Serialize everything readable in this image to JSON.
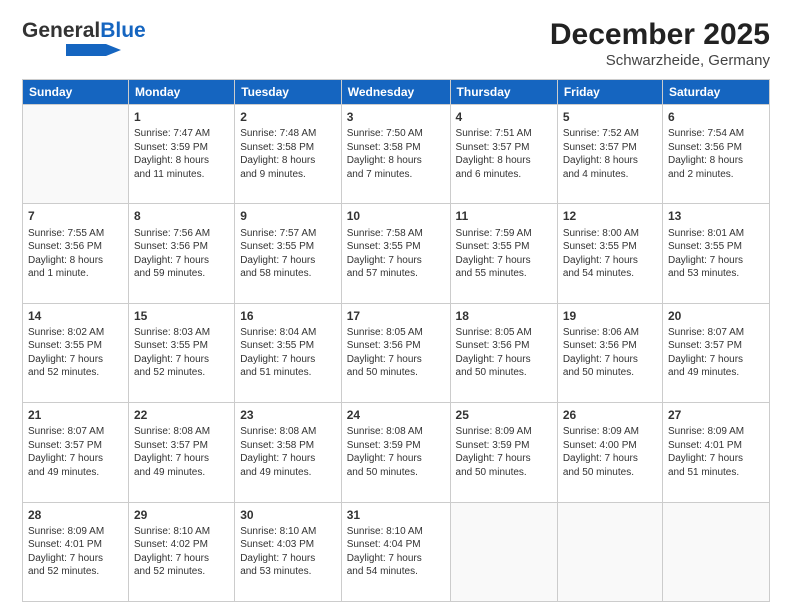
{
  "header": {
    "logo_general": "General",
    "logo_blue": "Blue",
    "month": "December 2025",
    "location": "Schwarzheide, Germany"
  },
  "weekdays": [
    "Sunday",
    "Monday",
    "Tuesday",
    "Wednesday",
    "Thursday",
    "Friday",
    "Saturday"
  ],
  "weeks": [
    [
      {
        "day": "",
        "info": ""
      },
      {
        "day": "1",
        "info": "Sunrise: 7:47 AM\nSunset: 3:59 PM\nDaylight: 8 hours\nand 11 minutes."
      },
      {
        "day": "2",
        "info": "Sunrise: 7:48 AM\nSunset: 3:58 PM\nDaylight: 8 hours\nand 9 minutes."
      },
      {
        "day": "3",
        "info": "Sunrise: 7:50 AM\nSunset: 3:58 PM\nDaylight: 8 hours\nand 7 minutes."
      },
      {
        "day": "4",
        "info": "Sunrise: 7:51 AM\nSunset: 3:57 PM\nDaylight: 8 hours\nand 6 minutes."
      },
      {
        "day": "5",
        "info": "Sunrise: 7:52 AM\nSunset: 3:57 PM\nDaylight: 8 hours\nand 4 minutes."
      },
      {
        "day": "6",
        "info": "Sunrise: 7:54 AM\nSunset: 3:56 PM\nDaylight: 8 hours\nand 2 minutes."
      }
    ],
    [
      {
        "day": "7",
        "info": "Sunrise: 7:55 AM\nSunset: 3:56 PM\nDaylight: 8 hours\nand 1 minute."
      },
      {
        "day": "8",
        "info": "Sunrise: 7:56 AM\nSunset: 3:56 PM\nDaylight: 7 hours\nand 59 minutes."
      },
      {
        "day": "9",
        "info": "Sunrise: 7:57 AM\nSunset: 3:55 PM\nDaylight: 7 hours\nand 58 minutes."
      },
      {
        "day": "10",
        "info": "Sunrise: 7:58 AM\nSunset: 3:55 PM\nDaylight: 7 hours\nand 57 minutes."
      },
      {
        "day": "11",
        "info": "Sunrise: 7:59 AM\nSunset: 3:55 PM\nDaylight: 7 hours\nand 55 minutes."
      },
      {
        "day": "12",
        "info": "Sunrise: 8:00 AM\nSunset: 3:55 PM\nDaylight: 7 hours\nand 54 minutes."
      },
      {
        "day": "13",
        "info": "Sunrise: 8:01 AM\nSunset: 3:55 PM\nDaylight: 7 hours\nand 53 minutes."
      }
    ],
    [
      {
        "day": "14",
        "info": "Sunrise: 8:02 AM\nSunset: 3:55 PM\nDaylight: 7 hours\nand 52 minutes."
      },
      {
        "day": "15",
        "info": "Sunrise: 8:03 AM\nSunset: 3:55 PM\nDaylight: 7 hours\nand 52 minutes."
      },
      {
        "day": "16",
        "info": "Sunrise: 8:04 AM\nSunset: 3:55 PM\nDaylight: 7 hours\nand 51 minutes."
      },
      {
        "day": "17",
        "info": "Sunrise: 8:05 AM\nSunset: 3:56 PM\nDaylight: 7 hours\nand 50 minutes."
      },
      {
        "day": "18",
        "info": "Sunrise: 8:05 AM\nSunset: 3:56 PM\nDaylight: 7 hours\nand 50 minutes."
      },
      {
        "day": "19",
        "info": "Sunrise: 8:06 AM\nSunset: 3:56 PM\nDaylight: 7 hours\nand 50 minutes."
      },
      {
        "day": "20",
        "info": "Sunrise: 8:07 AM\nSunset: 3:57 PM\nDaylight: 7 hours\nand 49 minutes."
      }
    ],
    [
      {
        "day": "21",
        "info": "Sunrise: 8:07 AM\nSunset: 3:57 PM\nDaylight: 7 hours\nand 49 minutes."
      },
      {
        "day": "22",
        "info": "Sunrise: 8:08 AM\nSunset: 3:57 PM\nDaylight: 7 hours\nand 49 minutes."
      },
      {
        "day": "23",
        "info": "Sunrise: 8:08 AM\nSunset: 3:58 PM\nDaylight: 7 hours\nand 49 minutes."
      },
      {
        "day": "24",
        "info": "Sunrise: 8:08 AM\nSunset: 3:59 PM\nDaylight: 7 hours\nand 50 minutes."
      },
      {
        "day": "25",
        "info": "Sunrise: 8:09 AM\nSunset: 3:59 PM\nDaylight: 7 hours\nand 50 minutes."
      },
      {
        "day": "26",
        "info": "Sunrise: 8:09 AM\nSunset: 4:00 PM\nDaylight: 7 hours\nand 50 minutes."
      },
      {
        "day": "27",
        "info": "Sunrise: 8:09 AM\nSunset: 4:01 PM\nDaylight: 7 hours\nand 51 minutes."
      }
    ],
    [
      {
        "day": "28",
        "info": "Sunrise: 8:09 AM\nSunset: 4:01 PM\nDaylight: 7 hours\nand 52 minutes."
      },
      {
        "day": "29",
        "info": "Sunrise: 8:10 AM\nSunset: 4:02 PM\nDaylight: 7 hours\nand 52 minutes."
      },
      {
        "day": "30",
        "info": "Sunrise: 8:10 AM\nSunset: 4:03 PM\nDaylight: 7 hours\nand 53 minutes."
      },
      {
        "day": "31",
        "info": "Sunrise: 8:10 AM\nSunset: 4:04 PM\nDaylight: 7 hours\nand 54 minutes."
      },
      {
        "day": "",
        "info": ""
      },
      {
        "day": "",
        "info": ""
      },
      {
        "day": "",
        "info": ""
      }
    ]
  ]
}
